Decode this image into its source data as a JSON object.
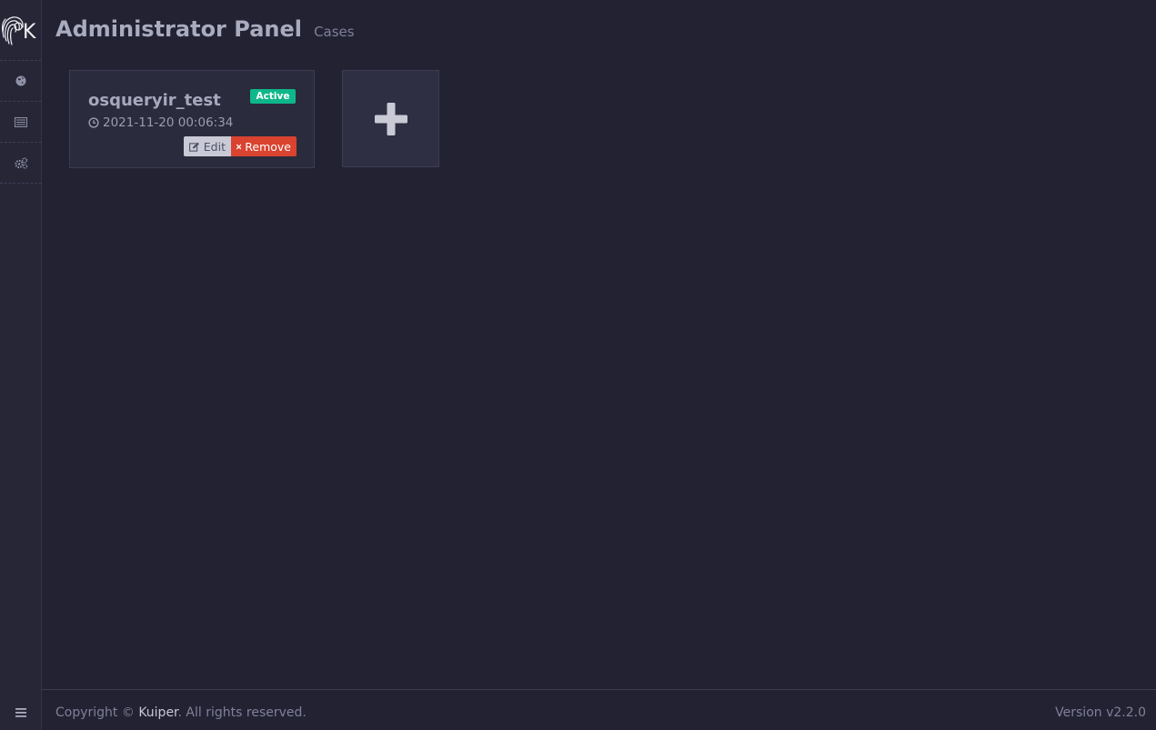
{
  "brand": {
    "logo_letter": "K"
  },
  "sidebar": {
    "items": [
      {
        "name": "globe-icon"
      },
      {
        "name": "list-icon"
      },
      {
        "name": "gears-icon"
      }
    ],
    "toggle_icon": "menu-icon"
  },
  "header": {
    "title": "Administrator Panel",
    "subtitle": "Cases"
  },
  "cases": [
    {
      "name": "osqueryir_test",
      "status": "Active",
      "date": "2021-11-20 00:06:34",
      "edit_label": "Edit",
      "remove_label": "Remove"
    }
  ],
  "footer": {
    "copyright_prefix": "Copyright © ",
    "brand_link": "Kuiper",
    "copyright_suffix": ". All rights reserved.",
    "version": "Version v2.2.0"
  },
  "colors": {
    "background": "#222233",
    "sidebar": "#262637",
    "active_badge": "#0eb78a",
    "remove": "#d9432f"
  }
}
